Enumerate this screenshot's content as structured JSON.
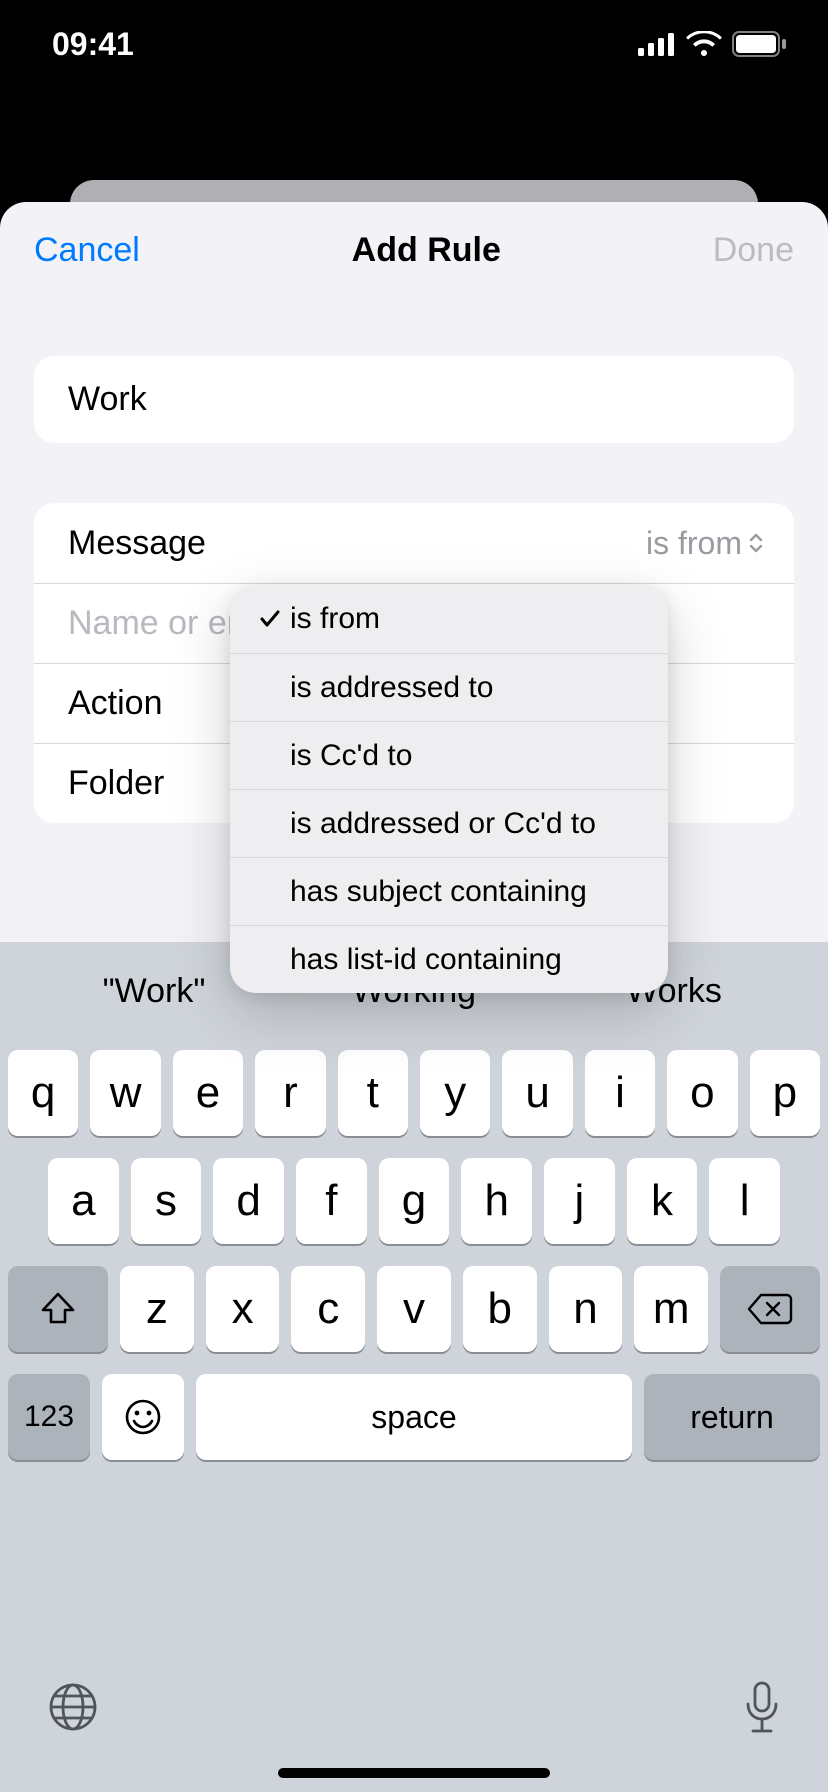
{
  "status": {
    "time": "09:41"
  },
  "nav": {
    "cancel": "Cancel",
    "title": "Add Rule",
    "done": "Done"
  },
  "form": {
    "rule_name": "Work",
    "message_label": "Message",
    "message_picker": "is from",
    "recipient_placeholder": "Name or email address",
    "action_label": "Action",
    "folder_label": "Folder"
  },
  "menu": {
    "options": [
      {
        "label": "is from",
        "selected": true
      },
      {
        "label": "is addressed to",
        "selected": false
      },
      {
        "label": "is Cc'd to",
        "selected": false
      },
      {
        "label": "is addressed or Cc'd to",
        "selected": false
      },
      {
        "label": "has subject containing",
        "selected": false
      },
      {
        "label": "has list-id containing",
        "selected": false
      }
    ]
  },
  "keyboard": {
    "suggestions": [
      "\"Work\"",
      "Working",
      "Works"
    ],
    "row1": [
      "q",
      "w",
      "e",
      "r",
      "t",
      "y",
      "u",
      "i",
      "o",
      "p"
    ],
    "row2": [
      "a",
      "s",
      "d",
      "f",
      "g",
      "h",
      "j",
      "k",
      "l"
    ],
    "row3": [
      "z",
      "x",
      "c",
      "v",
      "b",
      "n",
      "m"
    ],
    "num_key": "123",
    "space_key": "space",
    "return_key": "return"
  }
}
